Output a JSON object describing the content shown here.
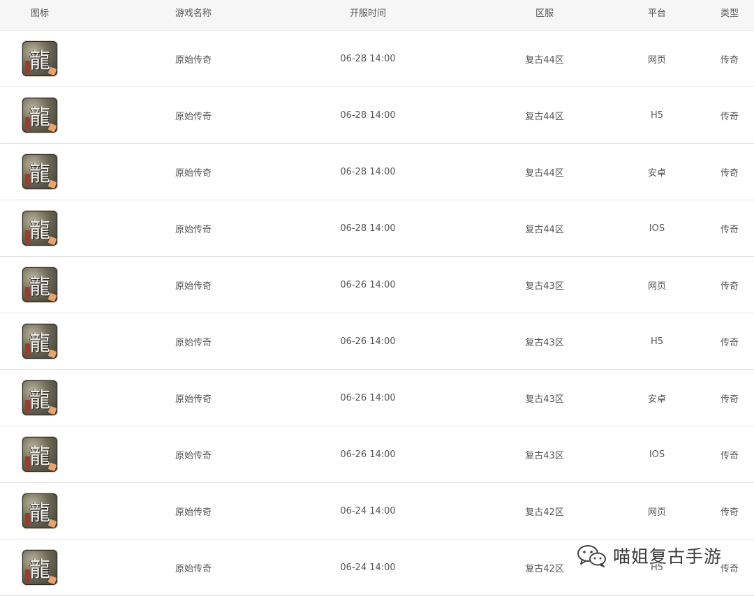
{
  "table": {
    "headers": {
      "icon": "图标",
      "name": "游戏名称",
      "time": "开服时间",
      "server": "区服",
      "platform": "平台",
      "type": "类型"
    },
    "rows": [
      {
        "icon": "dragon-game-icon",
        "name": "原始传奇",
        "time": "06-28 14:00",
        "server": "复古44区",
        "platform": "网页",
        "type": "传奇"
      },
      {
        "icon": "dragon-game-icon",
        "name": "原始传奇",
        "time": "06-28 14:00",
        "server": "复古44区",
        "platform": "H5",
        "type": "传奇"
      },
      {
        "icon": "dragon-game-icon",
        "name": "原始传奇",
        "time": "06-28 14:00",
        "server": "复古44区",
        "platform": "安卓",
        "type": "传奇"
      },
      {
        "icon": "dragon-game-icon",
        "name": "原始传奇",
        "time": "06-28 14:00",
        "server": "复古44区",
        "platform": "IOS",
        "type": "传奇"
      },
      {
        "icon": "dragon-game-icon",
        "name": "原始传奇",
        "time": "06-26 14:00",
        "server": "复古43区",
        "platform": "网页",
        "type": "传奇"
      },
      {
        "icon": "dragon-game-icon",
        "name": "原始传奇",
        "time": "06-26 14:00",
        "server": "复古43区",
        "platform": "H5",
        "type": "传奇"
      },
      {
        "icon": "dragon-game-icon",
        "name": "原始传奇",
        "time": "06-26 14:00",
        "server": "复古43区",
        "platform": "安卓",
        "type": "传奇"
      },
      {
        "icon": "dragon-game-icon",
        "name": "原始传奇",
        "time": "06-26 14:00",
        "server": "复古43区",
        "platform": "IOS",
        "type": "传奇"
      },
      {
        "icon": "dragon-game-icon",
        "name": "原始传奇",
        "time": "06-24 14:00",
        "server": "复古42区",
        "platform": "网页",
        "type": "传奇"
      },
      {
        "icon": "dragon-game-icon",
        "name": "原始传奇",
        "time": "06-24 14:00",
        "server": "复古42区",
        "platform": "H5",
        "type": "传奇"
      }
    ]
  },
  "icon_glyph": "龍",
  "watermark": {
    "text": "喵姐复古手游",
    "icon": "wechat-icon"
  }
}
